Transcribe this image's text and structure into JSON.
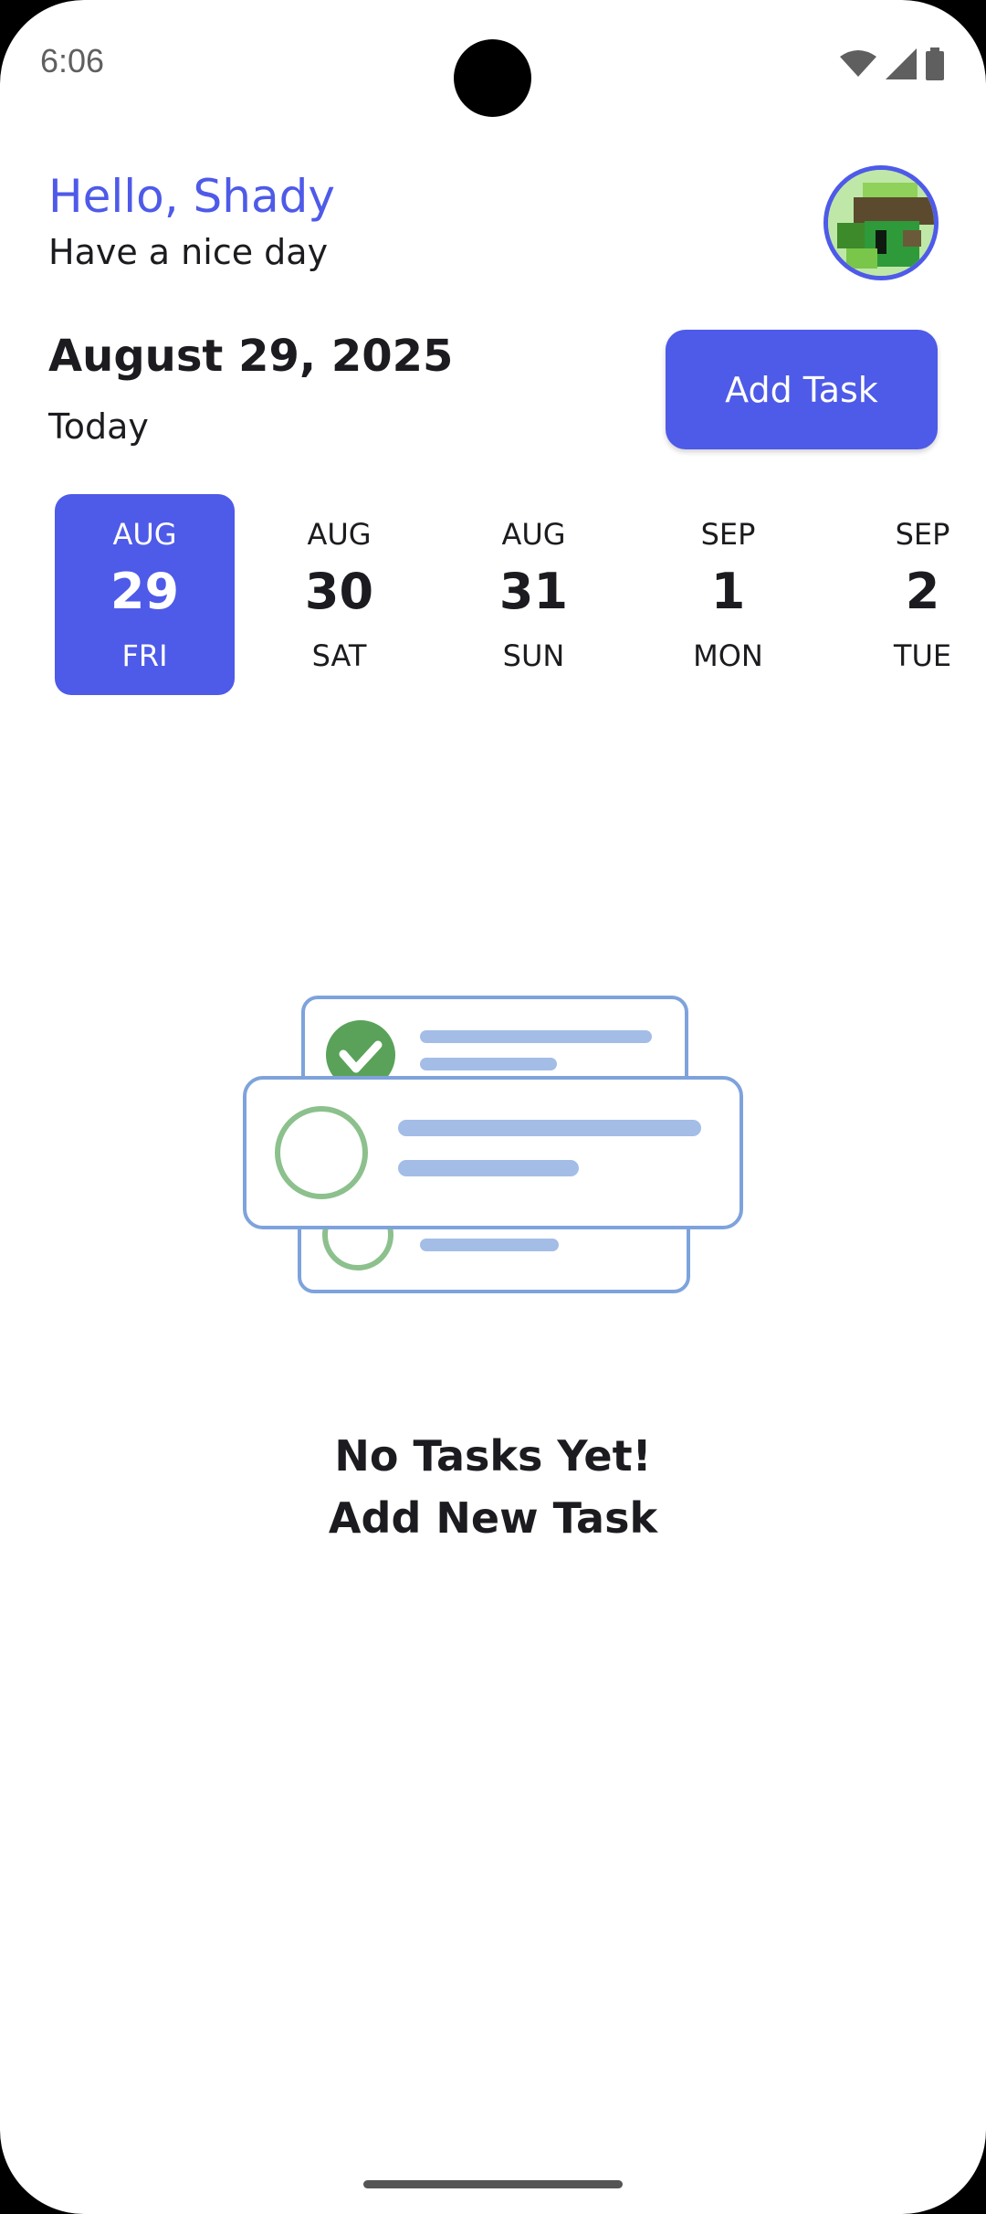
{
  "status_bar": {
    "time": "6:06"
  },
  "header": {
    "greeting": "Hello, Shady",
    "subtitle": "Have a nice day"
  },
  "date_section": {
    "date": "August 29, 2025",
    "label": "Today",
    "add_button": "Add Task"
  },
  "date_picker": [
    {
      "month": "AUG",
      "day": "29",
      "weekday": "FRI",
      "selected": true
    },
    {
      "month": "AUG",
      "day": "30",
      "weekday": "SAT",
      "selected": false
    },
    {
      "month": "AUG",
      "day": "31",
      "weekday": "SUN",
      "selected": false
    },
    {
      "month": "SEP",
      "day": "1",
      "weekday": "MON",
      "selected": false
    },
    {
      "month": "SEP",
      "day": "2",
      "weekday": "TUE",
      "selected": false
    }
  ],
  "empty_state": {
    "line1": "No Tasks Yet!",
    "line2": "Add New Task"
  },
  "colors": {
    "accent": "#4e5ae8",
    "text": "#1c1b1f"
  }
}
